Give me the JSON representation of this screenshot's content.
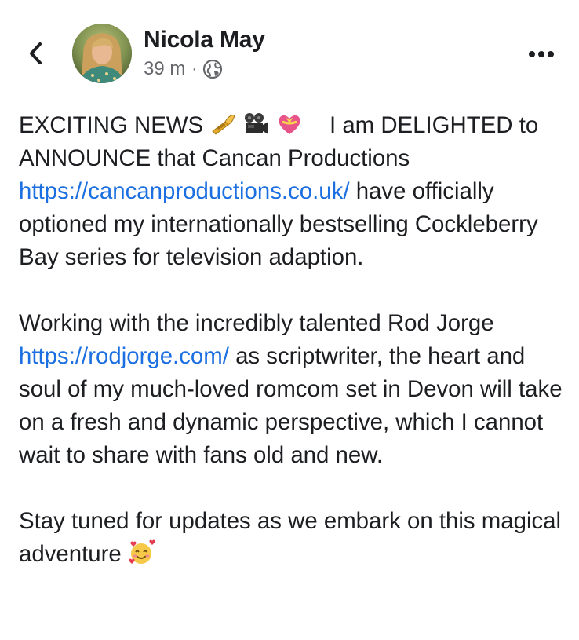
{
  "post": {
    "author": "Nicola May",
    "time": "39 m",
    "separator": "·",
    "audience_icon": "globe-icon",
    "back_icon": "chevron-left-icon",
    "more_icon": "more-horizontal-icon",
    "paragraphs": {
      "p1": {
        "before_emoji": "EXCITING NEWS",
        "emojis": [
          "trumpet-emoji",
          "movie-camera-emoji",
          "heart-with-ribbon-emoji"
        ],
        "after_emoji": "I am DELIGHTED to ANNOUNCE that Cancan Productions",
        "link": "https://cancanproductions.co.uk/",
        "after_link": "have officially optioned my internationally bestselling Cockleberry Bay series for television adaption."
      },
      "p2": {
        "before_link": "Working with the incredibly talented Rod Jorge",
        "link": "https://rodjorge.com/",
        "after_link": "as scriptwriter, the heart and soul of my much-loved romcom set in Devon will take on a fresh and dynamic perspective, which I cannot wait to share with fans old and new."
      },
      "p3": {
        "text": "Stay tuned for updates as we embark on this magical adventure",
        "emoji": "smiling-face-with-hearts-emoji"
      }
    }
  },
  "colors": {
    "link": "#1c6fe0",
    "text": "#1c1e21",
    "meta": "#65676b"
  }
}
